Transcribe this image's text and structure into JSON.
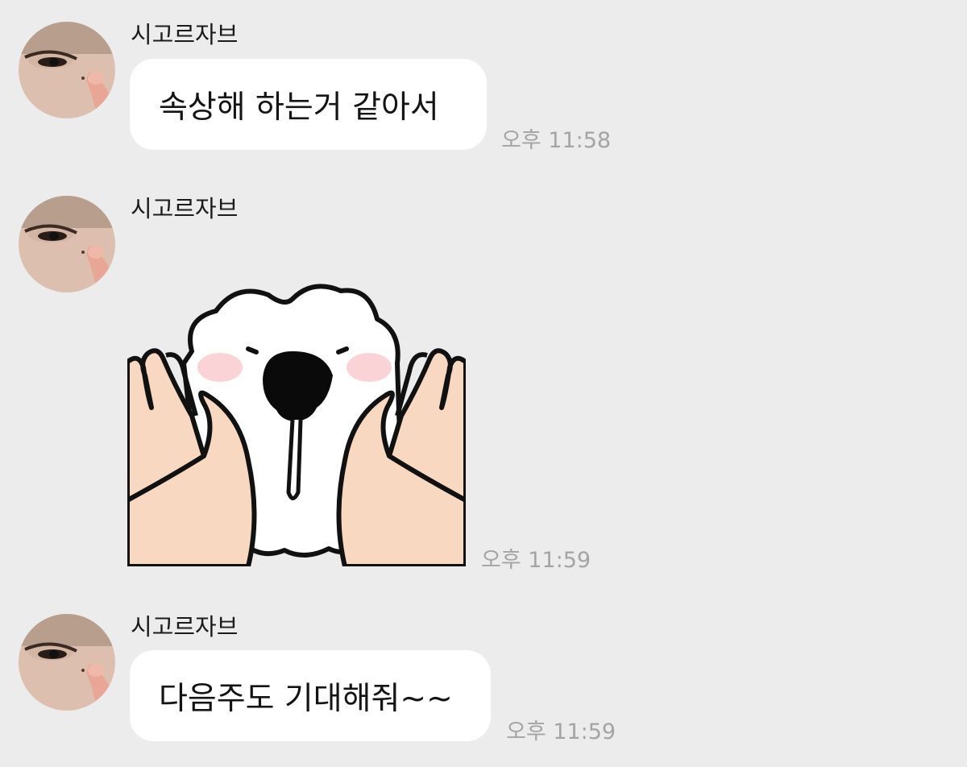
{
  "messages": [
    {
      "sender": "시고르자브",
      "type": "text",
      "text": "속상해 하는거 같아서",
      "time": "오후 11:58"
    },
    {
      "sender": "시고르자브",
      "type": "sticker",
      "sticker": "screaming-white-dog-sticker",
      "time": "오후 11:59"
    },
    {
      "sender": "시고르자브",
      "type": "text",
      "text": "다음주도 기대해줘~~",
      "time": "오후 11:59"
    }
  ],
  "colors": {
    "background": "#ececec",
    "bubble": "#ffffff",
    "time": "#a4a4a4",
    "text": "#141414"
  }
}
